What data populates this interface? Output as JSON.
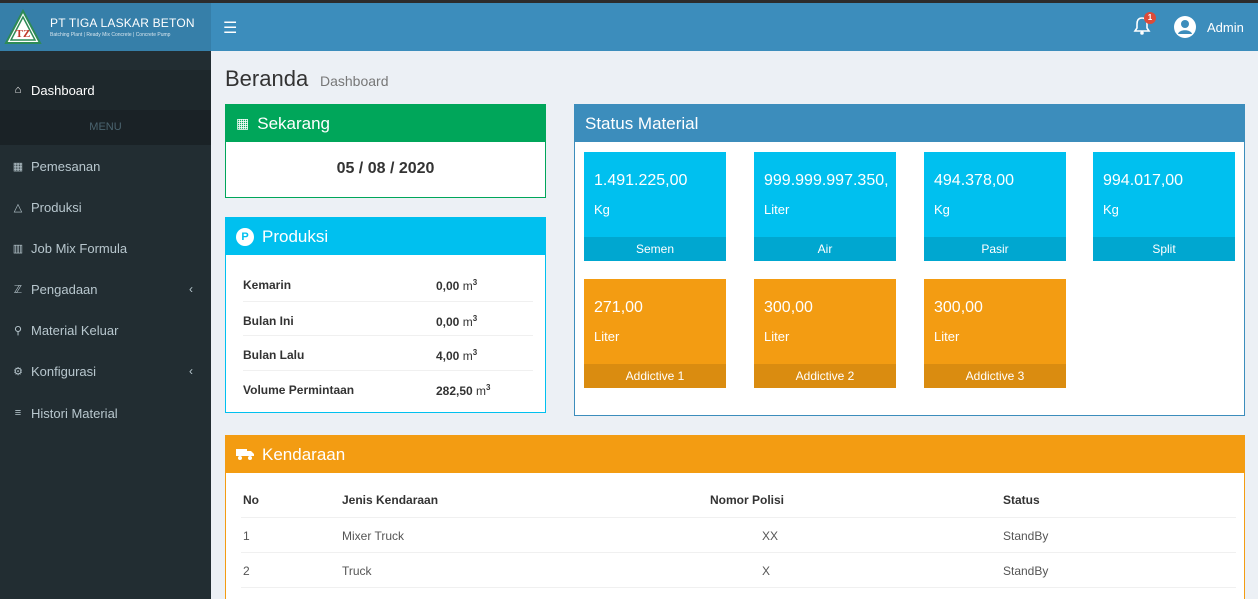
{
  "header": {
    "company": "PT TIGA LASKAR BETON",
    "tagline": "Batching Plant | Ready Mix Concrete | Concrete Pump",
    "notification_count": "1",
    "user": "Admin"
  },
  "sidebar": {
    "menu_header": "MENU",
    "items": [
      {
        "label": "Dashboard",
        "icon": "home-icon"
      },
      {
        "label": "Pemesanan",
        "icon": "calendar-icon"
      },
      {
        "label": "Produksi",
        "icon": "flask-icon"
      },
      {
        "label": "Job Mix Formula",
        "icon": "bar-chart-icon"
      },
      {
        "label": "Pengadaan",
        "icon": "cart-icon"
      },
      {
        "label": "Material Keluar",
        "icon": "search-icon"
      },
      {
        "label": "Konfigurasi",
        "icon": "gear-icon"
      },
      {
        "label": "Histori Material",
        "icon": "list-icon"
      }
    ]
  },
  "page": {
    "title": "Beranda",
    "subtitle": "Dashboard"
  },
  "sekarang": {
    "title": "Sekarang",
    "date": "05 / 08 / 2020"
  },
  "produksi": {
    "title": "Produksi",
    "unit": "m",
    "rows": [
      {
        "label": "Kemarin",
        "value": "0,00"
      },
      {
        "label": "Bulan Ini",
        "value": "0,00"
      },
      {
        "label": "Bulan Lalu",
        "value": "4,00"
      },
      {
        "label": "Volume Permintaan",
        "value": "282,50"
      }
    ]
  },
  "status_material": {
    "title": "Status Material",
    "tiles": [
      {
        "value": "1.491.225,00",
        "unit": "Kg",
        "name": "Semen",
        "color": "#00c0ef"
      },
      {
        "value": "999.999.997.350,",
        "unit": "Liter",
        "name": "Air",
        "color": "#00c0ef"
      },
      {
        "value": "494.378,00",
        "unit": "Kg",
        "name": "Pasir",
        "color": "#00c0ef"
      },
      {
        "value": "994.017,00",
        "unit": "Kg",
        "name": "Split",
        "color": "#00c0ef"
      },
      {
        "value": "271,00",
        "unit": "Liter",
        "name": "Addictive 1",
        "color": "#f39c12"
      },
      {
        "value": "300,00",
        "unit": "Liter",
        "name": "Addictive 2",
        "color": "#f39c12"
      },
      {
        "value": "300,00",
        "unit": "Liter",
        "name": "Addictive 3",
        "color": "#f39c12"
      }
    ]
  },
  "kendaraan": {
    "title": "Kendaraan",
    "columns": [
      "No",
      "Jenis Kendaraan",
      "Nomor Polisi",
      "Status"
    ],
    "rows": [
      [
        "1",
        "Mixer Truck",
        "XX",
        "StandBy"
      ],
      [
        "2",
        "Truck",
        "X",
        "StandBy"
      ]
    ]
  }
}
